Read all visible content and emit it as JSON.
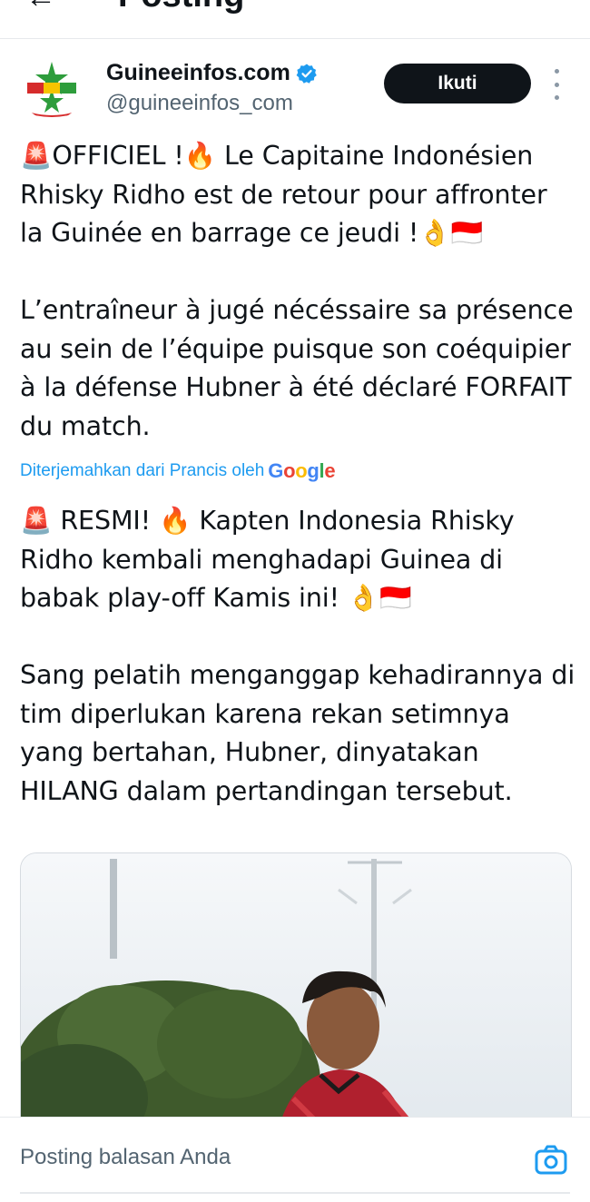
{
  "header": {
    "back_icon": "arrow-left-icon",
    "title": "Posting"
  },
  "author": {
    "name": "Guineeinfos.com",
    "handle": "@guineeinfos_com",
    "verified_icon": "verified-badge-icon",
    "follow_label": "Ikuti",
    "more_icon": "more-vertical-icon"
  },
  "post": {
    "original_text": "🚨OFFICIEL !🔥 Le Capitaine Indonésien Rhisky Ridho est de retour pour affronter la Guinée en barrage ce jeudi !👌🇮🇩\n\nL’entraîneur à jugé nécéssaire sa présence au sein de l’équipe puisque son coéquipier à la défense Hubner à été déclaré FORFAIT du match.",
    "translation_note": "Diterjemahkan dari Prancis oleh",
    "translation_brand": "Google",
    "translated_text": "🚨 RESMI! 🔥 Kapten Indonesia Rhisky Ridho kembali menghadapi Guinea di babak play-off Kamis ini! 👌🇮🇩\n\nSang pelatih menganggap kehadirannya di tim diperlukan karena rekan setimnya yang bertahan, Hubner, dinyatakan HILANG dalam pertandingan tersebut."
  },
  "reply": {
    "placeholder": "Posting balasan Anda",
    "camera_icon": "camera-icon"
  },
  "colors": {
    "link": "#1d9bf0",
    "follow_bg": "#0f1419",
    "text": "#0f1419",
    "muted": "#536471",
    "verified": "#1d9bf0"
  }
}
